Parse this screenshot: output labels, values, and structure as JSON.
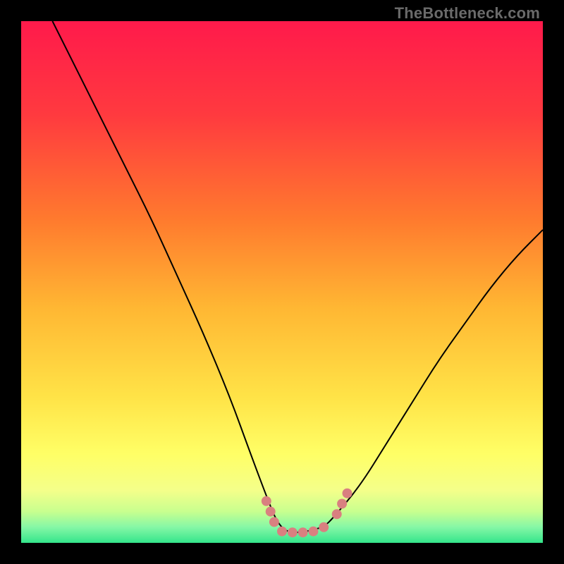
{
  "watermark": "TheBottleneck.com",
  "chart_data": {
    "type": "line",
    "title": "",
    "xlabel": "",
    "ylabel": "",
    "xlim": [
      0,
      100
    ],
    "ylim": [
      0,
      100
    ],
    "grid": false,
    "legend": false,
    "gradient_stops": [
      {
        "offset": 0.0,
        "color": "#ff1a4b"
      },
      {
        "offset": 0.18,
        "color": "#ff3a3f"
      },
      {
        "offset": 0.38,
        "color": "#ff7a2e"
      },
      {
        "offset": 0.55,
        "color": "#ffb733"
      },
      {
        "offset": 0.72,
        "color": "#ffe347"
      },
      {
        "offset": 0.83,
        "color": "#ffff66"
      },
      {
        "offset": 0.9,
        "color": "#f4ff8a"
      },
      {
        "offset": 0.94,
        "color": "#c8ff8f"
      },
      {
        "offset": 0.97,
        "color": "#85f7a6"
      },
      {
        "offset": 1.0,
        "color": "#34e58b"
      }
    ],
    "series": [
      {
        "name": "bottleneck-curve",
        "color": "#000000",
        "width": 2,
        "x": [
          6,
          10,
          15,
          20,
          25,
          30,
          35,
          40,
          44,
          47,
          49,
          51,
          54,
          58,
          60,
          65,
          70,
          75,
          80,
          85,
          90,
          95,
          100
        ],
        "y": [
          100,
          92,
          82,
          72,
          62,
          51,
          40,
          28,
          17,
          9,
          4,
          2,
          2,
          3,
          5,
          11,
          19,
          27,
          35,
          42,
          49,
          55,
          60
        ]
      }
    ],
    "valley_markers": {
      "color": "#d98080",
      "radius": 7,
      "points": [
        {
          "x": 47.0,
          "y": 8.0
        },
        {
          "x": 47.8,
          "y": 6.0
        },
        {
          "x": 48.5,
          "y": 4.0
        },
        {
          "x": 50.0,
          "y": 2.2
        },
        {
          "x": 52.0,
          "y": 2.0
        },
        {
          "x": 54.0,
          "y": 2.0
        },
        {
          "x": 56.0,
          "y": 2.2
        },
        {
          "x": 58.0,
          "y": 3.0
        },
        {
          "x": 60.5,
          "y": 5.5
        },
        {
          "x": 61.5,
          "y": 7.5
        },
        {
          "x": 62.5,
          "y": 9.5
        }
      ]
    }
  }
}
